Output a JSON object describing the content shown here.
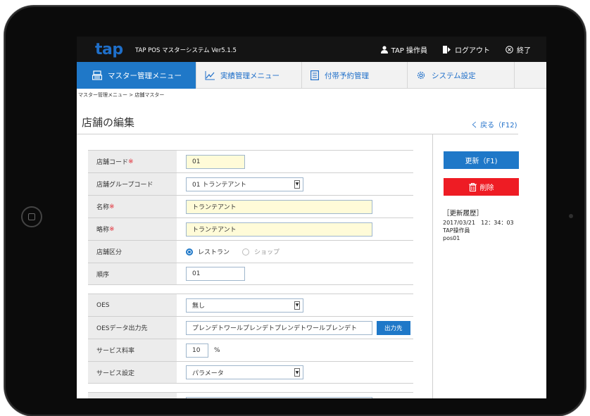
{
  "header": {
    "logo": "tap",
    "app_title": "TAP POS マスターシステム Ver5.1.5",
    "user": "TAP 操作員",
    "logout": "ログアウト",
    "exit": "終了"
  },
  "nav": {
    "tabs": [
      {
        "label": "マスター管理メニュー",
        "icon": "register-icon",
        "active": true
      },
      {
        "label": "実績管理メニュー",
        "icon": "line-chart-icon",
        "active": false
      },
      {
        "label": "付帯予約管理",
        "icon": "document-icon",
        "active": false
      },
      {
        "label": "システム設定",
        "icon": "gear-icon",
        "active": false
      }
    ]
  },
  "breadcrumb": "マスター管理メニュー > 店舗マスター",
  "page": {
    "title": "店舗の編集",
    "back": "く 戻る（F12)"
  },
  "form": {
    "required_mark": "※",
    "store_code": {
      "label": "店舗コード",
      "value": "01"
    },
    "group_code": {
      "label": "店舗グループコード",
      "value": "01 トランテアント"
    },
    "name": {
      "label": "名称",
      "value": "トランテアント"
    },
    "short_name": {
      "label": "略称",
      "value": "トランテアント"
    },
    "store_type": {
      "label": "店舗区分",
      "options": [
        "レストラン",
        "ショップ"
      ],
      "selected": "レストラン"
    },
    "order": {
      "label": "順序",
      "value": "01"
    },
    "oes": {
      "label": "OES",
      "value": "無し"
    },
    "oes_output": {
      "label": "OESデータ出力先",
      "value": "プレンデトワールプレンデトプレンデトワールプレンデト",
      "button": "出力先"
    },
    "service_rate": {
      "label": "サービス料率",
      "value": "10",
      "unit": "%"
    },
    "service_setting": {
      "label": "サービス設定",
      "value": "パラメータ"
    }
  },
  "actions": {
    "update": "更新（F1)",
    "delete": "削除"
  },
  "history": {
    "title": "［更新履歴］",
    "datetime": "2017/03/21　12：34：03",
    "user": "TAP操作員",
    "terminal": "pos01"
  },
  "colors": {
    "accent": "#1f78c8",
    "danger": "#ee1c24",
    "required_input": "#fffbd8",
    "header_bg": "#141414"
  }
}
